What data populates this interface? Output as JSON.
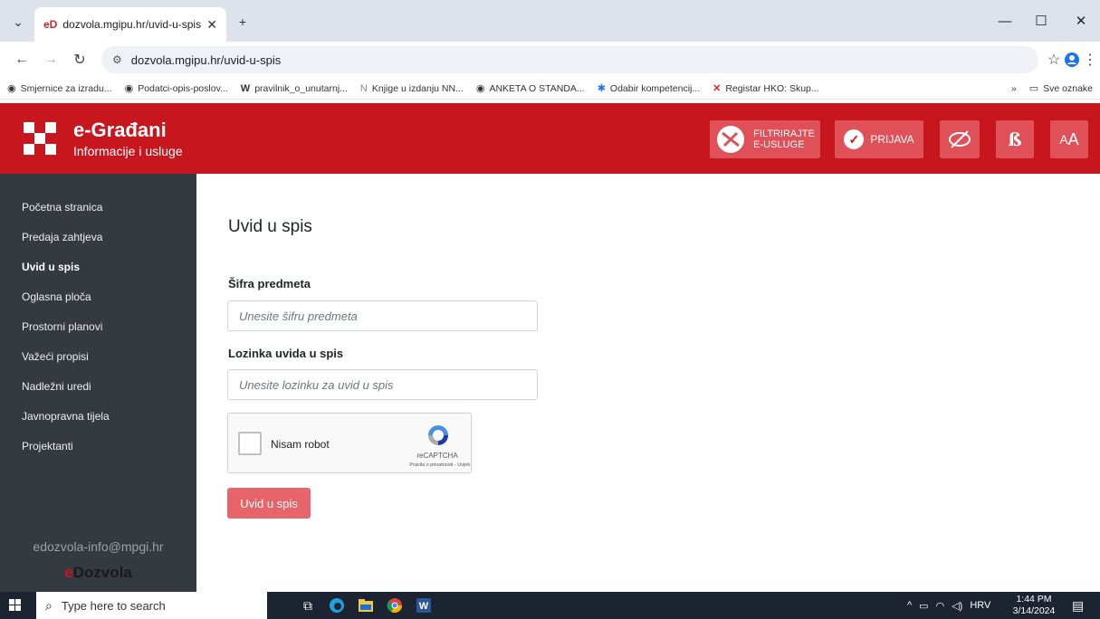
{
  "browser": {
    "tab_title": "dozvola.mgipu.hr/uvid-u-spis",
    "tab_favicon": "eD",
    "new_tab": "+",
    "tab_menu": "⌄",
    "url": "dozvola.mgipu.hr/uvid-u-spis",
    "bookmarks": [
      {
        "icon": "globe-icon",
        "label": "Smjernice za izradu..."
      },
      {
        "icon": "globe-icon",
        "label": "Podatci-opis-poslov..."
      },
      {
        "icon": "w-icon",
        "label": "pravilnik_o_unutarnj..."
      },
      {
        "icon": "nn-icon",
        "label": "Knjige u izdanju NN..."
      },
      {
        "icon": "globe-icon",
        "label": "ANKETA O STANDA..."
      },
      {
        "icon": "puzzle-icon",
        "label": "Odabir kompetencij..."
      },
      {
        "icon": "x-icon",
        "label": "Registar HKO: Skup..."
      }
    ],
    "more_bookmarks": "»",
    "all_bookmarks": "Sve oznake"
  },
  "header": {
    "title": "e-Građani",
    "subtitle": "Informacije i usluge",
    "filter_line1": "FILTRIRAJTE",
    "filter_line2": "E-USLUGE",
    "login": "PRIJAVA",
    "dyslexia_glyph": "ß",
    "aa_small": "A",
    "aa_large": "A",
    "color": "#c8161e"
  },
  "sidebar": {
    "items": [
      {
        "label": "Početna stranica",
        "active": false
      },
      {
        "label": "Predaja zahtjeva",
        "active": false
      },
      {
        "label": "Uvid u spis",
        "active": true
      },
      {
        "label": "Oglasna ploča",
        "active": false
      },
      {
        "label": "Prostorni planovi",
        "active": false
      },
      {
        "label": "Važeći propisi",
        "active": false
      },
      {
        "label": "Nadležni uredi",
        "active": false
      },
      {
        "label": "Javnopravna tijela",
        "active": false
      },
      {
        "label": "Projektanti",
        "active": false
      }
    ],
    "email": "edozvola-info@mpgi.hr",
    "brand_e": "e",
    "brand_rest": "Dozvola"
  },
  "main": {
    "title": "Uvid u spis",
    "case_label": "Šifra predmeta",
    "case_placeholder": "Unesite šifru predmeta",
    "password_label": "Lozinka uvida u spis",
    "password_placeholder": "Unesite lozinku za uvid u spis",
    "captcha_label": "Nisam robot",
    "captcha_brand": "reCAPTCHA",
    "captcha_terms": "Pravila o privatnosti - Uvjeti",
    "submit": "Uvid u spis"
  },
  "taskbar": {
    "search_placeholder": "Type here to search",
    "language": "HRV",
    "time": "1:44 PM",
    "date": "3/14/2024"
  }
}
